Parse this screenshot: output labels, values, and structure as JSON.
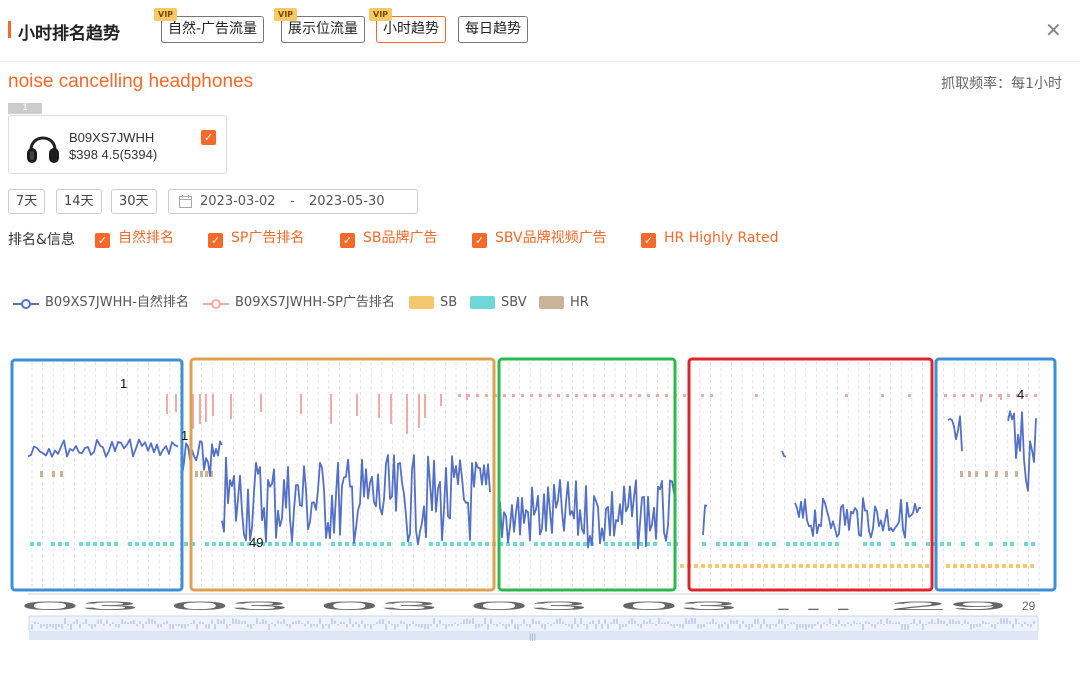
{
  "header": {
    "title": "小时排名趋势",
    "tabs": [
      {
        "label": "自然-广告流量",
        "vip": "VIP",
        "active": false
      },
      {
        "label": "展示位流量",
        "vip": "VIP",
        "active": false
      },
      {
        "label": "小时趋势",
        "vip": "VIP",
        "active": true
      },
      {
        "label": "每日趋势",
        "vip": "",
        "active": false
      }
    ],
    "close_icon": "close-icon"
  },
  "keyword": "noise cancelling headphones",
  "frequency": "抓取频率：每1小时",
  "product": {
    "index": "1",
    "asin": "B09XS7JWHH",
    "price_rating": "$398 4.5(5394)",
    "checked": true,
    "image_icon": "headphones-icon"
  },
  "range": {
    "buttons": [
      "7天",
      "14天",
      "30天"
    ],
    "start": "2023-03-02",
    "separator": "-",
    "end": "2023-05-30",
    "calendar_icon": "calendar-icon"
  },
  "filters": {
    "label": "排名&信息",
    "items": [
      "自然排名",
      "SP广告排名",
      "SB品牌广告",
      "SBV品牌视频广告",
      "HR Highly Rated"
    ]
  },
  "legend": [
    {
      "label": "B09XS7JWHH-自然排名",
      "color": "#5470c6"
    },
    {
      "label": "B09XS7JWHH-SP广告排名",
      "color": "#f2aaa6"
    },
    {
      "label": "SB",
      "color": "#f4c86f"
    },
    {
      "label": "SBV",
      "color": "#6fd8d8"
    },
    {
      "label": "HR",
      "color": "#c9b49a"
    }
  ],
  "chart_data": {
    "type": "line",
    "y_inverted": true,
    "annotations": [
      "1",
      "1",
      "49",
      "4"
    ],
    "x_tick_labels": "03 03 03 03 03 ... 29",
    "x_last_label": "29",
    "highlight_boxes": [
      {
        "color": "#3d8fd8"
      },
      {
        "color": "#e0a050"
      },
      {
        "color": "#2db84c"
      },
      {
        "color": "#e0242c"
      },
      {
        "color": "#3d8fd8"
      }
    ],
    "series": [
      {
        "name": "B09XS7JWHH-自然排名",
        "color": "#5470c6"
      },
      {
        "name": "B09XS7JWHH-SP广告排名",
        "color": "#f2aaa6"
      },
      {
        "name": "SB",
        "color": "#f4c86f"
      },
      {
        "name": "SBV",
        "color": "#6fd8d8"
      },
      {
        "name": "HR",
        "color": "#c9b49a"
      }
    ]
  }
}
